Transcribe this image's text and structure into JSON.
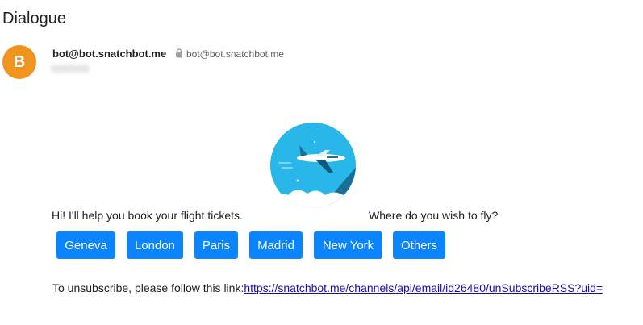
{
  "header": {
    "title": "Dialogue"
  },
  "sender": {
    "avatar_letter": "B",
    "avatar_color": "#f0941f",
    "name": "bot@bot.snatchbot.me",
    "address": "bot@bot.snatchbot.me"
  },
  "message": {
    "greeting": "Hi! I'll help you book your flight tickets.",
    "question": "Where do you wish to fly?",
    "logo_icon": "airplane-logo-icon",
    "buttons": [
      "Geneva",
      "London",
      "Paris",
      "Madrid",
      "New York",
      "Others"
    ],
    "button_color": "#0a84ff",
    "unsubscribe_text": "To unsubscribe, please follow this link:",
    "unsubscribe_link": "https://snatchbot.me/channels/api/email/id26480/unSubscribeRSS?uid="
  }
}
